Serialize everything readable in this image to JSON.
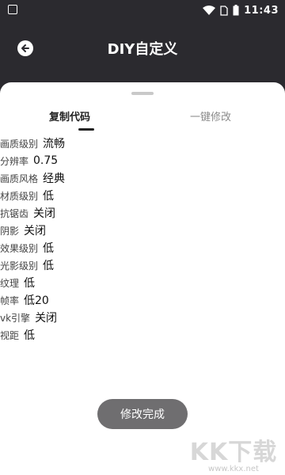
{
  "status_bar": {
    "time": "11:43"
  },
  "app_bar": {
    "title": "DIY自定义"
  },
  "tabs": [
    {
      "label": "复制代码",
      "active": true
    },
    {
      "label": "一键修改",
      "active": false
    }
  ],
  "settings": [
    {
      "label": "画质级别",
      "value": "流畅"
    },
    {
      "label": "分辨率",
      "value": "0.75"
    },
    {
      "label": "画质风格",
      "value": "经典"
    },
    {
      "label": "材质级别",
      "value": "低"
    },
    {
      "label": "抗锯齿",
      "value": "关闭"
    },
    {
      "label": "阴影",
      "value": "关闭"
    },
    {
      "label": "效果级别",
      "value": "低"
    },
    {
      "label": "光影级别",
      "value": "低"
    },
    {
      "label": "纹理",
      "value": "低"
    },
    {
      "label": "帧率",
      "value": "低20"
    },
    {
      "label": "vk引擎",
      "value": "关闭"
    },
    {
      "label": "视距",
      "value": "低"
    }
  ],
  "finish_button": "修改完成",
  "watermark": {
    "text": "KK下载",
    "url": "www.kkx.net"
  },
  "colors": {
    "header_bg": "#2b2a2f",
    "sheet_bg": "#ffffff",
    "button_bg": "#6f6e70"
  }
}
